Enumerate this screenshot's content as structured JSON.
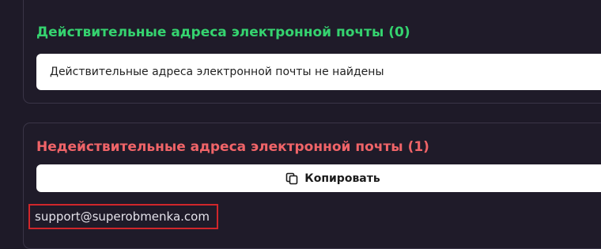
{
  "valid_section": {
    "title": "Действительные адреса электронной почты (0)",
    "empty_message": "Действительные адреса электронной почты не найдены"
  },
  "invalid_section": {
    "title": "Недействительные адреса электронной почты (1)",
    "copy_button_label": "Копировать",
    "copy_icon": "copy-icon",
    "emails": [
      "support@superobmenka.com"
    ]
  },
  "colors": {
    "valid_title": "#35d36f",
    "invalid_title": "#f06468",
    "highlight_border": "#d0262b",
    "background": "#1e1a28"
  }
}
